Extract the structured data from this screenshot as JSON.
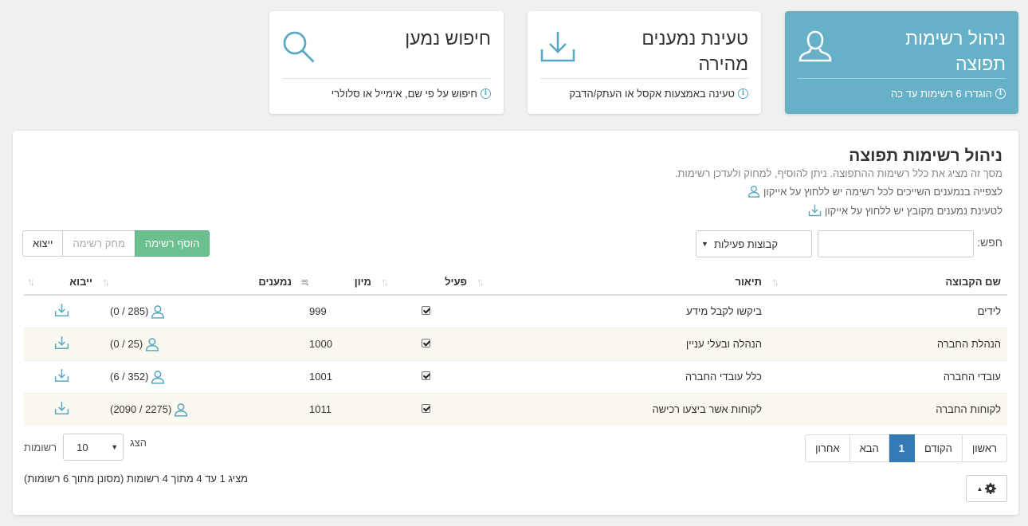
{
  "cards": {
    "lists": {
      "title_line1": "ניהול רשימות",
      "title_line2": "תפוצה",
      "footer": "הוגדרו 6 רשימות עד כה"
    },
    "upload": {
      "title_line1": "טעינת נמענים",
      "title_line2": "מהירה",
      "footer": "טעינה באמצעות אקסל או העתק/הדבק"
    },
    "search": {
      "title_line1": "חיפוש נמען",
      "footer": "חיפוש על פי שם, אימייל או סלולרי"
    }
  },
  "panel": {
    "title": "ניהול רשימות תפוצה",
    "description": "מסך זה מציג את כלל רשימות ההתפוצה. ניתן להוסיף, למחוק ולעדכן רשימות.",
    "help_members": "לצפייה בנמענים השייכים לכל רשימה יש ללחוץ על אייקון",
    "help_upload": "לטעינת נמענים מקובץ יש ללחוץ על אייקון"
  },
  "toolbar": {
    "search_label": "חפש:",
    "search_placeholder": "",
    "group_select": "קבוצות פעילות",
    "add_button": "הוסף רשימה",
    "delete_button": "מחק רשימה",
    "export_button": "ייצוא"
  },
  "table": {
    "headers": {
      "name": "שם הקבוצה",
      "description": "תיאור",
      "active": "פעיל",
      "sort": "מיון",
      "members": "נמענים",
      "import": "ייבוא"
    },
    "rows": [
      {
        "name": "לידים",
        "description": "ביקשו לקבל מידע",
        "sort": "999",
        "members": "(0 / 285)"
      },
      {
        "name": "הנהלת החברה",
        "description": "הנהלה ובעלי עניין",
        "sort": "1000",
        "members": "(0 / 25)"
      },
      {
        "name": "עובדי החברה",
        "description": "כלל עובדי החברה",
        "sort": "1001",
        "members": "(6 / 352)"
      },
      {
        "name": "לקוחות החברה",
        "description": "לקוחות אשר ביצעו רכישה",
        "sort": "1011",
        "members": "(2090 / 2275)"
      }
    ]
  },
  "pager": {
    "first": "ראשון",
    "prev": "הקודם",
    "current": "1",
    "next": "הבא",
    "last": "אחרון"
  },
  "length": {
    "show": "הצג",
    "value": "10",
    "records": "רשומות"
  },
  "info": "מציג 1 עד 4 מתוך 4 רשומות (מסונן מתוך 6 רשומות)",
  "colors": {
    "accent": "#66b0c8",
    "green": "#6cc08f",
    "pager_active": "#337ab7"
  },
  "icons": {
    "user": "user-icon",
    "download": "download-icon",
    "search": "search-icon",
    "gear": "gear-icon",
    "info": "info-icon"
  }
}
